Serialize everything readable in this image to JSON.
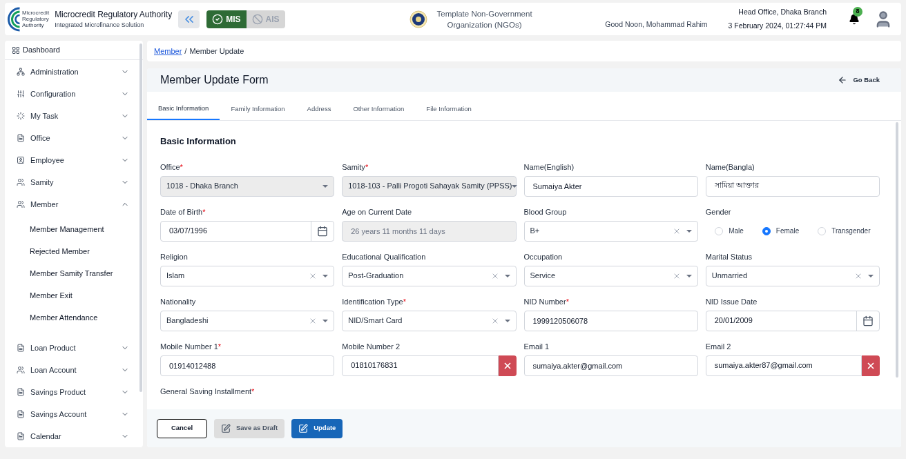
{
  "header": {
    "org_title": "Microcredit Regulatory Authority",
    "org_subtitle": "Integrated Microfinance Solution",
    "logo_text": [
      "Microcredit",
      "Regulatory",
      "Authority"
    ],
    "modules": [
      {
        "label": "MIS",
        "selected": true
      },
      {
        "label": "AIS",
        "selected": false
      }
    ],
    "ngo_name": "Template Non-Government Organization (NGOs)",
    "greeting": "Good Noon, Mohammad Rahim",
    "branch": "Head Office, Dhaka Branch",
    "datetime": "3 February 2024, 01:27:44 PM",
    "notifications": "8"
  },
  "sidebar": {
    "dashboard": "Dashboard",
    "items": [
      {
        "label": "Administration",
        "expanded": false
      },
      {
        "label": "Configuration",
        "expanded": false
      },
      {
        "label": "My Task",
        "expanded": false
      },
      {
        "label": "Office",
        "expanded": false
      },
      {
        "label": "Employee",
        "expanded": false
      },
      {
        "label": "Samity",
        "expanded": false
      },
      {
        "label": "Member",
        "expanded": true,
        "children": [
          "Member Management",
          "Rejected Member",
          "Member Samity Transfer",
          "Member Exit",
          "Member Attendance"
        ]
      },
      {
        "label": "Loan Product",
        "expanded": false
      },
      {
        "label": "Loan Account",
        "expanded": false
      },
      {
        "label": "Savings Product",
        "expanded": false
      },
      {
        "label": "Savings Account",
        "expanded": false
      },
      {
        "label": "Calendar",
        "expanded": false
      }
    ]
  },
  "breadcrumb": {
    "link": "Member",
    "separator": "/",
    "current": "Member Update"
  },
  "required_mark": "*",
  "page_title": "Member Update Form",
  "go_back": "Go Back",
  "tabs": [
    {
      "label": "Basic Information",
      "selected": true
    },
    {
      "label": "Family Information",
      "selected": false
    },
    {
      "label": "Address",
      "selected": false
    },
    {
      "label": "Other Information",
      "selected": false
    },
    {
      "label": "File Information",
      "selected": false
    }
  ],
  "section_title": "Basic Information",
  "fields": [
    {
      "kind": "select",
      "label": "Office",
      "required": true,
      "value": "1018 - Dhaka Branch",
      "disabled": true,
      "clearable": false
    },
    {
      "kind": "select",
      "label": "Samity",
      "required": true,
      "value": "1018-103 - Palli Progoti Sahayak Samity (PPSS)",
      "disabled": true,
      "clearable": false
    },
    {
      "kind": "text",
      "label": "Name(English)",
      "required": false,
      "value": "Sumaiya Akter"
    },
    {
      "kind": "text",
      "label": "Name(Bangla)",
      "required": false,
      "value": "সামিয়া আক্তার"
    },
    {
      "kind": "date",
      "label": "Date of Birth",
      "required": true,
      "value": "03/07/1996"
    },
    {
      "kind": "readonly",
      "label": "Age on Current Date",
      "required": false,
      "value": "26 years 11 months 11 days"
    },
    {
      "kind": "select",
      "label": "Blood Group",
      "required": false,
      "value": "B+",
      "disabled": false,
      "clearable": true
    },
    {
      "kind": "radio",
      "label": "Gender",
      "required": false,
      "options": [
        {
          "label": "Male",
          "selected": false
        },
        {
          "label": "Female",
          "selected": true
        },
        {
          "label": "Transgender",
          "selected": false
        }
      ]
    },
    {
      "kind": "select",
      "label": "Religion",
      "required": false,
      "value": "Islam",
      "disabled": false,
      "clearable": true
    },
    {
      "kind": "select",
      "label": "Educational Qualification",
      "required": false,
      "value": "Post-Graduation",
      "disabled": false,
      "clearable": true
    },
    {
      "kind": "select",
      "label": "Occupation",
      "required": false,
      "value": "Service",
      "disabled": false,
      "clearable": true
    },
    {
      "kind": "select",
      "label": "Marital Status",
      "required": false,
      "value": "Unmarried",
      "disabled": false,
      "clearable": true
    },
    {
      "kind": "select",
      "label": "Nationality",
      "required": false,
      "value": "Bangladeshi",
      "disabled": false,
      "clearable": true
    },
    {
      "kind": "select",
      "label": "Identification Type",
      "required": true,
      "value": "NID/Smart Card",
      "disabled": false,
      "clearable": true
    },
    {
      "kind": "text",
      "label": "NID Number",
      "required": true,
      "value": "1999120506078"
    },
    {
      "kind": "date",
      "label": "NID Issue Date",
      "required": false,
      "value": "20/01/2009"
    },
    {
      "kind": "text",
      "label": "Mobile Number 1",
      "required": true,
      "value": "01914012488"
    },
    {
      "kind": "removable",
      "label": "Mobile Number 2",
      "required": false,
      "value": "01810176831"
    },
    {
      "kind": "text",
      "label": "Email 1",
      "required": false,
      "value": "sumaiya.akter@gmail.com"
    },
    {
      "kind": "removable",
      "label": "Email 2",
      "required": false,
      "value": "sumaiya.akter87@gmail.com"
    },
    {
      "kind": "label",
      "label": "General Saving Installment",
      "required": true
    }
  ],
  "footer_buttons": [
    {
      "kind": "outline",
      "label": "Cancel",
      "disabled": false
    },
    {
      "kind": "secondary",
      "label": "Save as Draft",
      "disabled": true
    },
    {
      "kind": "primary",
      "label": "Update",
      "disabled": false
    }
  ]
}
